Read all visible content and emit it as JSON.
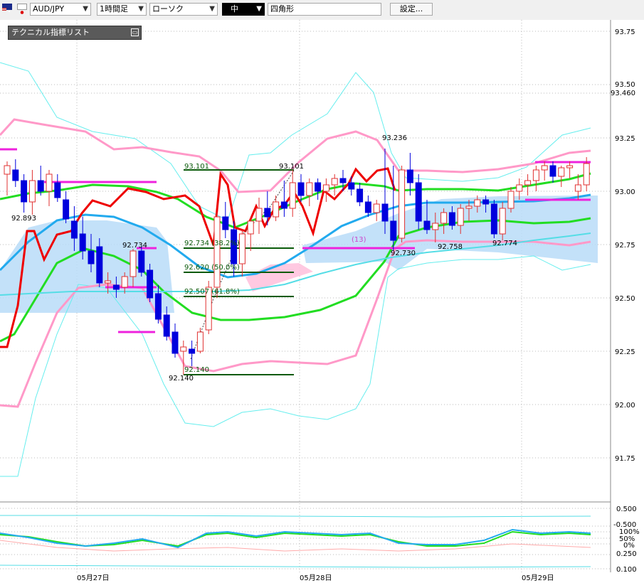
{
  "toolbar": {
    "symbol": "AUD/JPY",
    "timeframe": "1時間足",
    "chart_type": "ローソク",
    "size": "中",
    "drawing_tool": "四角形",
    "settings_label": "設定..."
  },
  "indicator_panel": {
    "title": "テクニカル指標リスト"
  },
  "price_axis": {
    "ticks": [
      "93.75",
      "93.50",
      "93.460",
      "93.25",
      "93.00",
      "92.75",
      "92.50",
      "92.25",
      "92.00",
      "91.75"
    ],
    "tick_values": [
      93.75,
      93.5,
      93.46,
      93.25,
      93.0,
      92.75,
      92.5,
      92.25,
      92.0,
      91.75
    ]
  },
  "osc_axis": {
    "ticks": [
      "0.500",
      "-0.500",
      "100%",
      "50%",
      "0%",
      "0.250",
      "0.100"
    ]
  },
  "date_axis": {
    "labels": [
      "05月27日",
      "05月28日",
      "05月29日"
    ]
  },
  "annotations": {
    "swing_labels": [
      "92.893",
      "92.734",
      "92.140",
      "93.236",
      "93.101",
      "92.730",
      "92.758",
      "92.774"
    ],
    "fib_labels": [
      "93.101",
      "92.734 (38.2%)",
      "92.620 (50.0%)",
      "92.507 (61.8%)",
      "92.140"
    ],
    "ichimoku_label": "(13)"
  },
  "colors": {
    "bullish": "#e03030",
    "bearish": "#0000dd",
    "bollinger_inner": "#ff99c8",
    "bollinger_outer": "#66eeee",
    "ma_green": "#22dd22",
    "ma_blue": "#22aaee",
    "line_red": "#ee0000",
    "cloud": "#b8dcf8",
    "fib_line": "#0a5a0a",
    "magenta": "#ee22dd"
  },
  "chart_data": {
    "type": "candlestick",
    "ylim": [
      91.5,
      93.85
    ],
    "candles": [
      [
        93.08,
        93.14,
        92.98,
        93.12
      ],
      [
        93.1,
        93.15,
        93.02,
        93.05
      ],
      [
        93.05,
        93.08,
        92.9,
        92.95
      ],
      [
        92.95,
        93.1,
        92.89,
        93.05
      ],
      [
        93.05,
        93.12,
        92.98,
        93.0
      ],
      [
        93.0,
        93.1,
        92.93,
        93.08
      ],
      [
        93.04,
        93.08,
        92.95,
        92.97
      ],
      [
        92.96,
        93.0,
        92.85,
        92.87
      ],
      [
        92.86,
        92.93,
        92.72,
        92.78
      ],
      [
        92.8,
        92.88,
        92.68,
        92.72
      ],
      [
        92.72,
        92.8,
        92.62,
        92.66
      ],
      [
        92.74,
        92.78,
        92.55,
        92.57
      ],
      [
        92.57,
        92.62,
        92.52,
        92.58
      ],
      [
        92.56,
        92.6,
        92.5,
        92.54
      ],
      [
        92.55,
        92.62,
        92.52,
        92.6
      ],
      [
        92.6,
        92.73,
        92.55,
        92.72
      ],
      [
        92.72,
        92.74,
        92.6,
        92.62
      ],
      [
        92.63,
        92.66,
        92.48,
        92.5
      ],
      [
        92.52,
        92.56,
        92.38,
        92.4
      ],
      [
        92.42,
        92.46,
        92.3,
        92.32
      ],
      [
        92.34,
        92.38,
        92.22,
        92.24
      ],
      [
        92.25,
        92.3,
        92.14,
        92.27
      ],
      [
        92.26,
        92.3,
        92.18,
        92.24
      ],
      [
        92.25,
        92.36,
        92.24,
        92.34
      ],
      [
        92.35,
        92.58,
        92.33,
        92.55
      ],
      [
        92.55,
        92.9,
        92.5,
        92.88
      ],
      [
        92.88,
        92.95,
        92.78,
        92.82
      ],
      [
        92.82,
        92.86,
        92.6,
        92.66
      ],
      [
        92.66,
        92.82,
        92.6,
        92.8
      ],
      [
        92.8,
        92.88,
        92.72,
        92.86
      ],
      [
        92.86,
        92.97,
        92.8,
        92.92
      ],
      [
        92.92,
        93.0,
        92.84,
        92.88
      ],
      [
        92.88,
        92.98,
        92.86,
        92.95
      ],
      [
        92.95,
        93.05,
        92.88,
        92.92
      ],
      [
        92.92,
        93.1,
        92.88,
        93.04
      ],
      [
        93.04,
        93.08,
        92.95,
        92.98
      ],
      [
        92.98,
        93.06,
        92.93,
        93.04
      ],
      [
        93.04,
        93.06,
        92.96,
        93.0
      ],
      [
        93.0,
        93.06,
        92.95,
        93.03
      ],
      [
        93.03,
        93.08,
        92.98,
        93.06
      ],
      [
        93.06,
        93.1,
        93.0,
        93.04
      ],
      [
        93.04,
        93.07,
        92.98,
        93.01
      ],
      [
        93.01,
        93.04,
        92.93,
        92.95
      ],
      [
        92.95,
        92.98,
        92.88,
        92.9
      ],
      [
        92.9,
        92.96,
        92.86,
        92.94
      ],
      [
        92.94,
        93.2,
        92.8,
        92.86
      ],
      [
        92.86,
        93.12,
        92.72,
        92.77
      ],
      [
        92.78,
        93.12,
        92.76,
        93.1
      ],
      [
        93.1,
        93.18,
        92.98,
        93.04
      ],
      [
        93.04,
        93.08,
        92.82,
        92.86
      ],
      [
        92.86,
        92.96,
        92.8,
        92.82
      ],
      [
        92.82,
        92.9,
        92.76,
        92.85
      ],
      [
        92.85,
        92.92,
        92.8,
        92.9
      ],
      [
        92.9,
        92.93,
        92.82,
        92.84
      ],
      [
        92.84,
        92.94,
        92.8,
        92.92
      ],
      [
        92.92,
        92.96,
        92.86,
        92.93
      ],
      [
        92.93,
        92.98,
        92.9,
        92.96
      ],
      [
        92.96,
        92.98,
        92.9,
        92.94
      ],
      [
        92.94,
        92.96,
        92.78,
        92.8
      ],
      [
        92.8,
        92.95,
        92.77,
        92.92
      ],
      [
        92.92,
        93.02,
        92.9,
        93.0
      ],
      [
        93.0,
        93.06,
        92.96,
        93.03
      ],
      [
        93.03,
        93.08,
        92.98,
        93.05
      ],
      [
        93.05,
        93.12,
        93.0,
        93.1
      ],
      [
        93.1,
        93.14,
        93.05,
        93.12
      ],
      [
        93.12,
        93.14,
        93.04,
        93.07
      ],
      [
        93.07,
        93.12,
        93.02,
        93.11
      ],
      [
        93.11,
        93.14,
        93.06,
        93.12
      ],
      [
        93.0,
        93.08,
        92.96,
        93.03
      ],
      [
        93.03,
        93.16,
        93.0,
        93.13
      ]
    ]
  }
}
